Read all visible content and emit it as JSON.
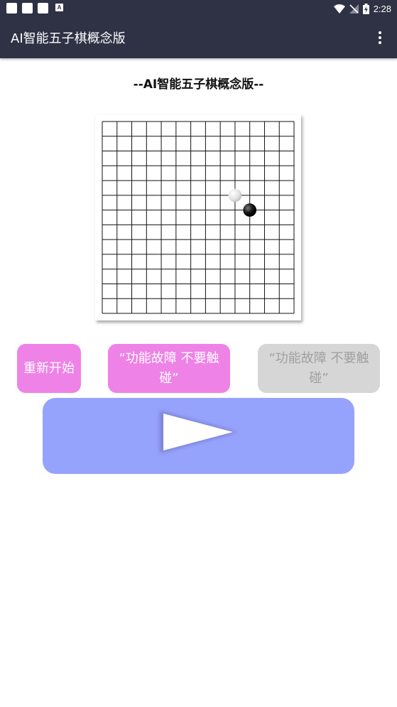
{
  "status_bar": {
    "time": "2:28",
    "notification_icons": [
      "app-icon",
      "app-icon",
      "app-icon",
      "a-icon"
    ],
    "system_icons": [
      "wifi-icon",
      "no-sim-icon",
      "battery-charging-icon"
    ],
    "a_glyph": "A"
  },
  "app_bar": {
    "title": "AI智能五子棋概念版",
    "menu_icon": "more-vert-icon"
  },
  "heading": "--AI智能五子棋概念版--",
  "board": {
    "lines": 14,
    "stones": [
      {
        "color": "white",
        "col": 9,
        "row": 5
      },
      {
        "color": "black",
        "col": 10,
        "row": 6
      }
    ]
  },
  "buttons": {
    "restart": "重新开始",
    "fault_active": "“功能故障 不要触碰”",
    "fault_disabled": "“功能故障 不要触碰”"
  },
  "play_button": {
    "icon": "play-icon"
  },
  "colors": {
    "bar": "#2f3145",
    "pink_button": "#ee82e6",
    "gray_button": "#d6d6d6",
    "play_panel": "#96a3fd"
  }
}
